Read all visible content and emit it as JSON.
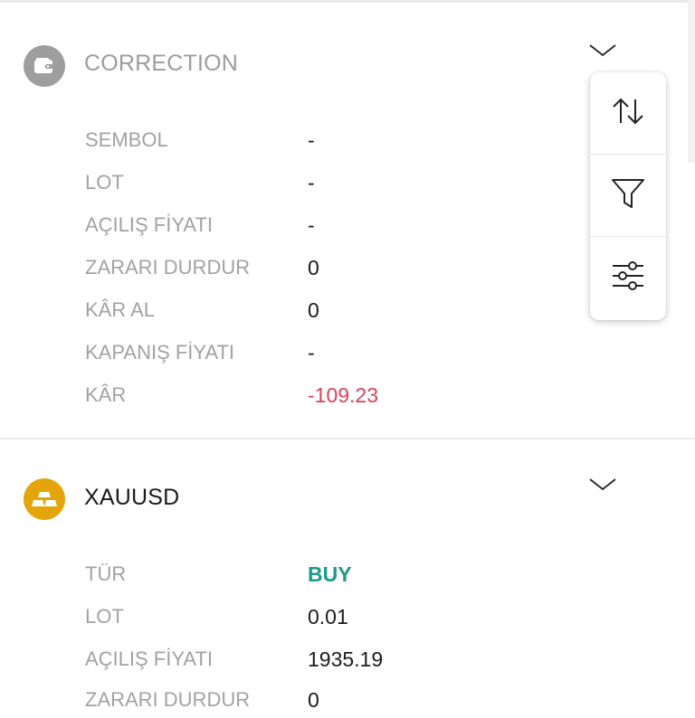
{
  "colors": {
    "label": "#a2a2a2",
    "value": "#1c1c1c",
    "negative": "#d9435a",
    "buy": "#1f9a87",
    "wallet_icon_bg": "#9e9e9e",
    "gold_icon_bg": "#e3a50a"
  },
  "card1": {
    "icon": "wallet-icon",
    "title": "CORRECTION",
    "rows": [
      {
        "label": "SEMBOL",
        "value": "-"
      },
      {
        "label": "LOT",
        "value": "-"
      },
      {
        "label": "AÇILIŞ FİYATI",
        "value": "-"
      },
      {
        "label": "ZARARI DURDUR",
        "value": "0"
      },
      {
        "label": "KÂR AL",
        "value": "0"
      },
      {
        "label": "KAPANIŞ FİYATI",
        "value": "-"
      },
      {
        "label": "KÂR",
        "value": "-109.23"
      }
    ]
  },
  "card2": {
    "icon": "gold-bars-icon",
    "title": "XAUUSD",
    "rows": [
      {
        "label": "TÜR",
        "value": "BUY"
      },
      {
        "label": "LOT",
        "value": "0.01"
      },
      {
        "label": "AÇILIŞ FİYATI",
        "value": "1935.19"
      },
      {
        "label": "ZARARI DURDUR",
        "value": "0"
      }
    ]
  },
  "menu": {
    "items": [
      {
        "icon": "sort-arrows-icon"
      },
      {
        "icon": "filter-funnel-icon"
      },
      {
        "icon": "sliders-icon"
      }
    ]
  }
}
